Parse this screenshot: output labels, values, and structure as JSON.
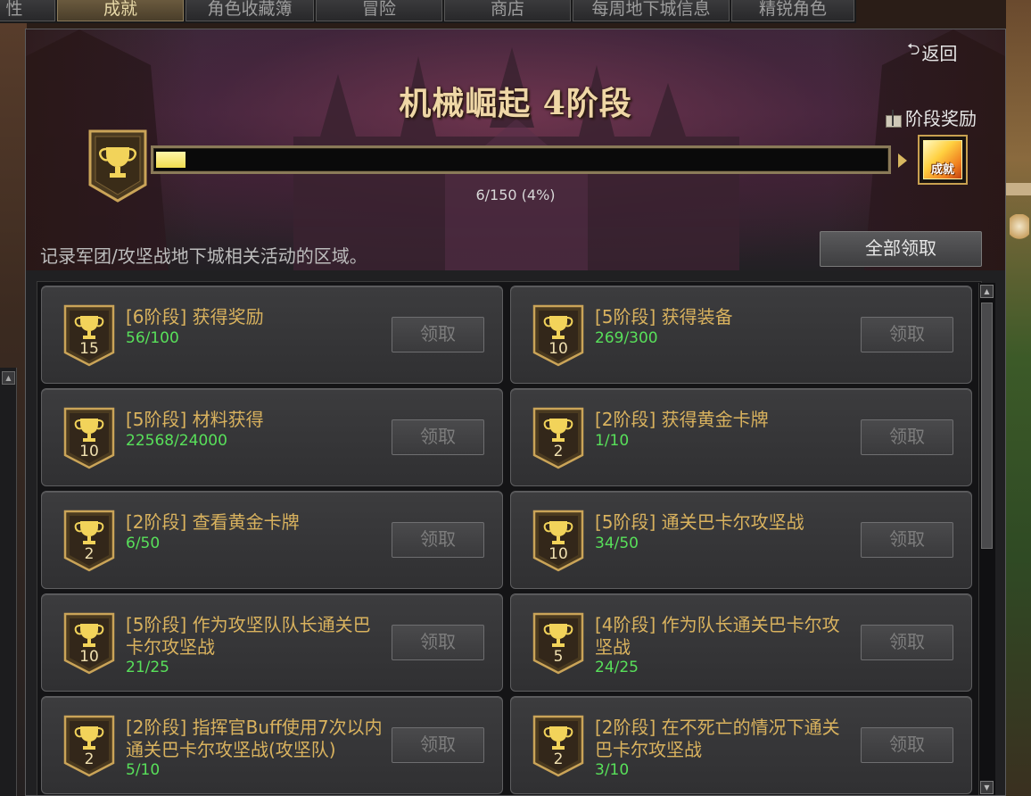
{
  "tabs": [
    {
      "label": "性",
      "active": false
    },
    {
      "label": "成就",
      "active": true
    },
    {
      "label": "角色收藏簿",
      "active": false
    },
    {
      "label": "冒险",
      "active": false
    },
    {
      "label": "商店",
      "active": false
    },
    {
      "label": "每周地下城信息",
      "active": false
    },
    {
      "label": "精锐角色",
      "active": false
    }
  ],
  "header": {
    "back_label": "返回",
    "title": "机械崛起 4阶段",
    "stage_reward_label": "阶段奖励",
    "reward_icon_text": "成就",
    "progress_text": "6/150 (4%)",
    "progress_fraction": 0.04
  },
  "description": "记录军团/攻坚战地下城相关活动的区域。",
  "claim_all_label": "全部领取",
  "achievements": [
    {
      "points": "15",
      "title": "[6阶段] 获得奖励",
      "progress": "56/100",
      "button": "领取"
    },
    {
      "points": "10",
      "title": "[5阶段] 获得装备",
      "progress": "269/300",
      "button": "领取"
    },
    {
      "points": "10",
      "title": "[5阶段] 材料获得",
      "progress": "22568/24000",
      "button": "领取"
    },
    {
      "points": "2",
      "title": "[2阶段] 获得黄金卡牌",
      "progress": "1/10",
      "button": "领取"
    },
    {
      "points": "2",
      "title": "[2阶段] 查看黄金卡牌",
      "progress": "6/50",
      "button": "领取"
    },
    {
      "points": "10",
      "title": "[5阶段] 通关巴卡尔攻坚战",
      "progress": "34/50",
      "button": "领取"
    },
    {
      "points": "10",
      "title": "[5阶段] 作为攻坚队队长通关巴卡尔攻坚战",
      "progress": "21/25",
      "button": "领取"
    },
    {
      "points": "5",
      "title": "[4阶段] 作为队长通关巴卡尔攻坚战",
      "progress": "24/25",
      "button": "领取"
    },
    {
      "points": "2",
      "title": "[2阶段] 指挥官Buff使用7次以内通关巴卡尔攻坚战(攻坚队)",
      "progress": "5/10",
      "button": "领取"
    },
    {
      "points": "2",
      "title": "[2阶段] 在不死亡的情况下通关巴卡尔攻坚战",
      "progress": "3/10",
      "button": "领取"
    }
  ],
  "colors": {
    "accent_gold": "#d9b25e",
    "progress_green": "#58e05a",
    "bar_fill": "#f0dc50"
  }
}
